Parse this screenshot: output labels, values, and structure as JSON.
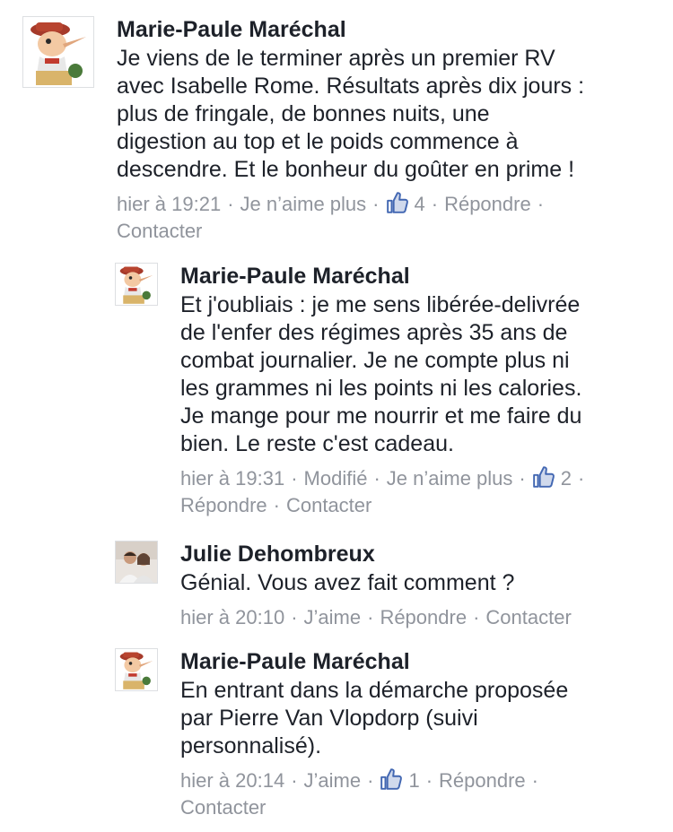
{
  "comments": [
    {
      "author": "Marie-Paule Maréchal",
      "text_lines": [
        "Je viens de le terminer après un premier RV",
        "avec Isabelle Rome. Résultats après dix jours :",
        "plus de fringale, de bonnes nuits, une",
        "digestion au top et le poids commence à",
        "descendre. Et le bonheur du goûter en prime !"
      ],
      "time": "hier à 19:21",
      "like_action": "Je n’aime plus",
      "like_count": "4",
      "reply": "Répondre",
      "contact": "Contacter",
      "avatar_icon": "pinocchio-avatar-icon"
    },
    {
      "author": "Marie-Paule Maréchal",
      "text_lines": [
        "Et j'oubliais : je me sens libérée-delivrée",
        "de l'enfer des régimes après 35 ans de",
        "combat journalier. Je ne compte plus ni",
        "les grammes ni les points ni les calories.",
        "Je mange pour me nourrir et me faire du",
        "bien. Le reste c'est cadeau."
      ],
      "time": "hier à 19:31",
      "edited": "Modifié",
      "like_action": "Je n’aime plus",
      "like_count": "2",
      "reply": "Répondre",
      "contact": "Contacter",
      "avatar_icon": "pinocchio-avatar-icon"
    },
    {
      "author": "Julie Dehombreux",
      "text_lines": [
        "Génial.  Vous avez fait comment ?"
      ],
      "time": "hier à 20:10",
      "like_action": "J’aime",
      "reply": "Répondre",
      "contact": "Contacter",
      "avatar_icon": "user-photo-avatar"
    },
    {
      "author": "Marie-Paule Maréchal",
      "text_lines": [
        "En entrant dans la démarche proposée",
        "par Pierre Van Vlopdorp (suivi",
        "personnalisé)."
      ],
      "time": "hier à 20:14",
      "like_action": "J’aime",
      "like_count": "1",
      "reply": "Répondre",
      "contact": "Contacter",
      "avatar_icon": "pinocchio-avatar-icon"
    }
  ],
  "colors": {
    "text": "#1d2129",
    "meta": "#90949c",
    "like_blue": "#4267b2"
  },
  "icons": {
    "like": "thumbs-up-icon",
    "separator": "·"
  }
}
